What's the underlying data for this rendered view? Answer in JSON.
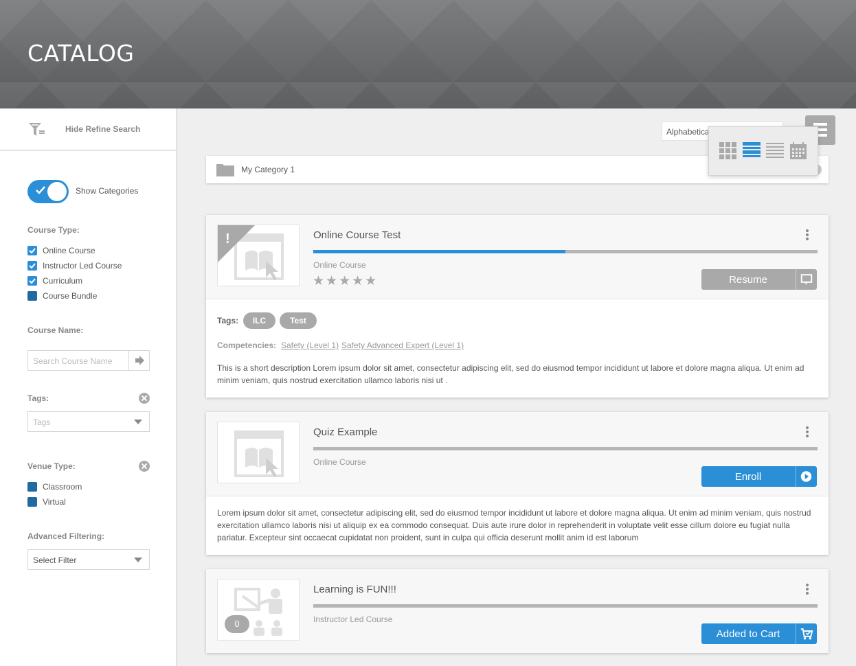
{
  "header": {
    "title": "CATALOG"
  },
  "sidebar": {
    "refine_label": "Hide Refine Search",
    "show_categories_label": "Show Categories",
    "course_type": {
      "label": "Course Type:",
      "options": [
        {
          "label": "Online Course",
          "checked": true
        },
        {
          "label": "Instructor Led Course",
          "checked": true
        },
        {
          "label": "Curriculum",
          "checked": true
        },
        {
          "label": "Course Bundle",
          "checked": false
        }
      ]
    },
    "course_name": {
      "label": "Course Name:",
      "placeholder": "Search Course Name"
    },
    "tags": {
      "label": "Tags:",
      "placeholder": "Tags"
    },
    "venue_type": {
      "label": "Venue Type:",
      "options": [
        {
          "label": "Classroom",
          "checked": false
        },
        {
          "label": "Virtual",
          "checked": false
        }
      ]
    },
    "advanced": {
      "label": "Advanced Filtering:",
      "value": "Select Filter"
    }
  },
  "main": {
    "sort_value": "Alphabetical",
    "category": "My Category 1",
    "courses": [
      {
        "title": "Online Course Test",
        "type": "Online Course",
        "progress": 0.5,
        "rating_stars": "★★★★★",
        "action": "Resume",
        "tags_label": "Tags:",
        "tags": [
          "ILC",
          "Test"
        ],
        "competencies_label": "Competencies:",
        "competencies": [
          "Safety (Level 1)",
          "Safety Advanced Expert (Level 1)"
        ],
        "description": "This is a short description Lorem ipsum dolor sit amet, consectetur adipiscing elit, sed do eiusmod tempor incididunt ut labore et dolore magna aliqua. Ut enim ad minim veniam, quis nostrud exercitation ullamco laboris nisi ut ."
      },
      {
        "title": "Quiz Example",
        "type": "Online Course",
        "progress": 0,
        "action": "Enroll",
        "description": "Lorem ipsum dolor sit amet, consectetur adipiscing elit, sed do eiusmod tempor incididunt ut labore et dolore magna aliqua. Ut enim ad minim veniam, quis nostrud exercitation ullamco laboris nisi ut aliquip ex ea commodo consequat. Duis aute irure dolor in reprehenderit in voluptate velit esse cillum dolore eu fugiat nulla pariatur. Excepteur sint occaecat cupidatat non proident, sunt in culpa qui officia deserunt mollit anim id est laborum"
      },
      {
        "title": "Learning is FUN!!!",
        "type": "Instructor Led Course",
        "progress": 0,
        "action": "Added to Cart",
        "count": "0"
      }
    ]
  },
  "colors": {
    "accent": "#2a8fd6",
    "muted": "#a9a9a9"
  }
}
